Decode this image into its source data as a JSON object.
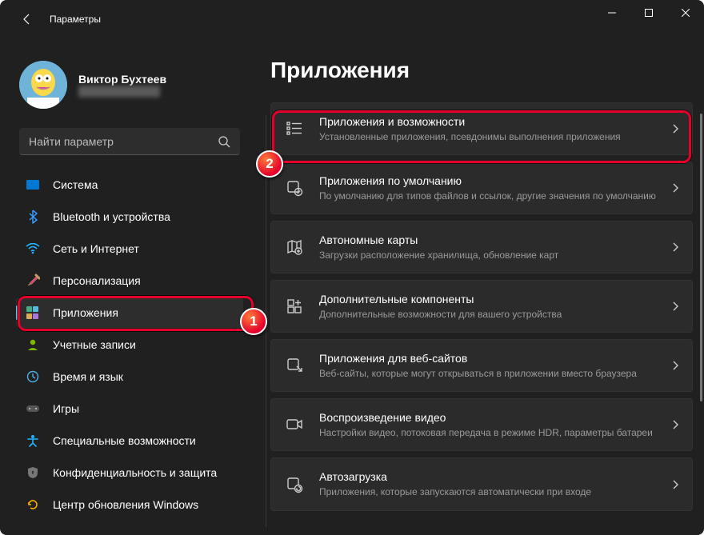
{
  "window": {
    "title": "Параметры"
  },
  "profile": {
    "name": "Виктор Бухтеев",
    "sub": "████████████"
  },
  "search": {
    "placeholder": "Найти параметр"
  },
  "sidebar": {
    "items": [
      {
        "label": "Система"
      },
      {
        "label": "Bluetooth и устройства"
      },
      {
        "label": "Сеть и Интернет"
      },
      {
        "label": "Персонализация"
      },
      {
        "label": "Приложения"
      },
      {
        "label": "Учетные записи"
      },
      {
        "label": "Время и язык"
      },
      {
        "label": "Игры"
      },
      {
        "label": "Специальные возможности"
      },
      {
        "label": "Конфиденциальность и защита"
      },
      {
        "label": "Центр обновления Windows"
      }
    ]
  },
  "main": {
    "title": "Приложения",
    "cards": [
      {
        "title": "Приложения и возможности",
        "sub": "Установленные приложения, псевдонимы выполнения приложения"
      },
      {
        "title": "Приложения по умолчанию",
        "sub": "По умолчанию для типов файлов и ссылок, другие значения по умолчанию"
      },
      {
        "title": "Автономные карты",
        "sub": "Загрузки расположение хранилища, обновление карт"
      },
      {
        "title": "Дополнительные компоненты",
        "sub": "Дополнительные возможности для вашего устройства"
      },
      {
        "title": "Приложения для веб-сайтов",
        "sub": "Веб-сайты, которые могут открываться в приложении вместо браузера"
      },
      {
        "title": "Воспроизведение видео",
        "sub": "Настройки видео, потоковая передача в режиме HDR, параметры батареи"
      },
      {
        "title": "Автозагрузка",
        "sub": "Приложения, которые запускаются автоматически при входе"
      }
    ]
  },
  "callouts": {
    "one": "1",
    "two": "2"
  }
}
